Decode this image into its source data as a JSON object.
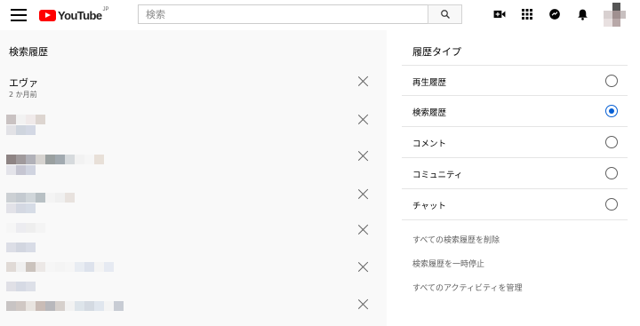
{
  "header": {
    "logo_text": "YouTube",
    "logo_region": "JP",
    "search_placeholder": "検索"
  },
  "history": {
    "section_title": "検索履歴",
    "items": [
      {
        "query": "エヴァ",
        "time": "2 か月前"
      }
    ]
  },
  "history_type": {
    "title": "履歴タイプ",
    "options": [
      {
        "label": "再生履歴",
        "selected": false
      },
      {
        "label": "検索履歴",
        "selected": true
      },
      {
        "label": "コメント",
        "selected": false
      },
      {
        "label": "コミュニティ",
        "selected": false
      },
      {
        "label": "チャット",
        "selected": false
      }
    ],
    "actions": [
      "すべての検索履歴を削除",
      "検索履歴を一時停止",
      "すべてのアクティビティを管理"
    ]
  },
  "colors": {
    "brand_red": "#ff0000",
    "accent_blue": "#065fd4",
    "icon_dark": "#030303"
  },
  "icons": [
    "menu-icon",
    "search-icon",
    "create-video-icon",
    "apps-icon",
    "messages-icon",
    "notifications-bell-icon",
    "close-icon"
  ]
}
